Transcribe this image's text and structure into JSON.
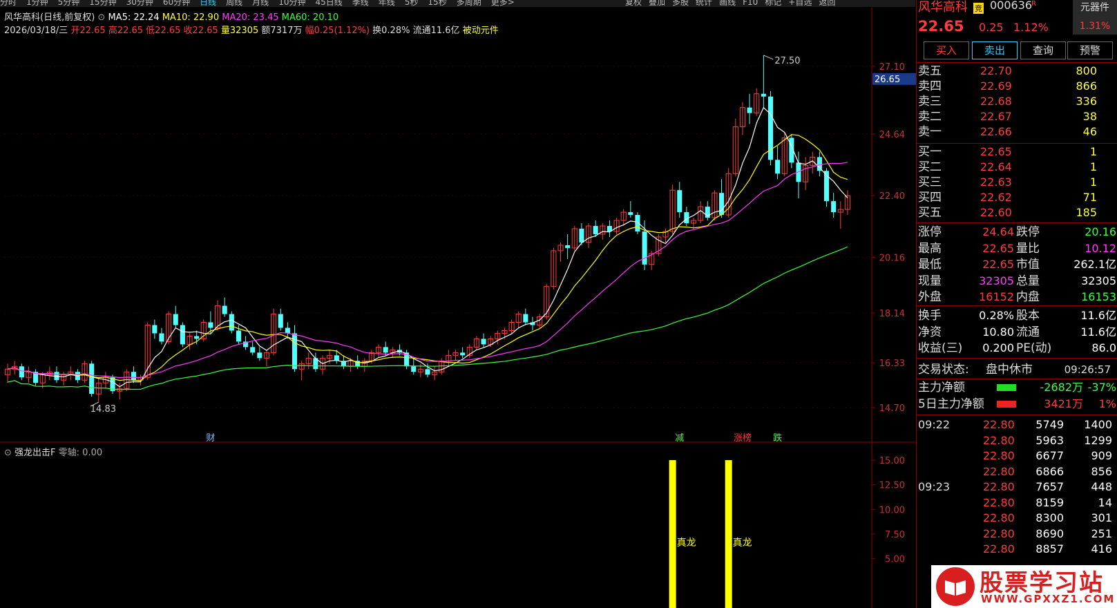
{
  "topbar": {
    "periods": [
      "分时",
      "1分钟",
      "5分钟",
      "15分钟",
      "30分钟",
      "60分钟",
      "日线",
      "周线",
      "月线",
      "10分钟",
      "45日线",
      "季线",
      "年线",
      "5秒",
      "15秒",
      "多周期",
      "更多>"
    ],
    "active": "日线",
    "right_tools": [
      "复权",
      "叠加",
      "多股",
      "统计",
      "画线",
      "F10",
      "标记",
      "+自选",
      "返回"
    ]
  },
  "header": {
    "stock": "风华高科(日线,前复权)",
    "ma5": "MA5: 22.24",
    "ma10": "MA10: 22.90",
    "ma20": "MA20: 23.45",
    "ma60": "MA60: 20.10",
    "date": "2026/03/18/三",
    "open": "开22.65",
    "high": "高22.65",
    "low": "低22.65",
    "close": "收22.65",
    "vol": "量32305",
    "amount": "额7317万",
    "change": "幅0.25(1.12%)",
    "turnover": "换0.28%",
    "float": "流通11.6亿",
    "passive": "被动元件"
  },
  "colors": {
    "up": "#ff3c3c",
    "down": "#54ffff",
    "ma5": "#ffffff",
    "ma10": "#ffff00",
    "ma20": "#ff3cff",
    "ma60": "#3cff3c",
    "grid": "#8b0000"
  },
  "chart_data": {
    "type": "candlestick",
    "price_axis": [
      "27.10",
      "24.64",
      "22.40",
      "20.16",
      "18.14",
      "16.33",
      "14.70"
    ],
    "current_price_tag": "26.65",
    "high_label": "27.50",
    "low_label": "14.83",
    "event_markers": [
      {
        "text": "财",
        "color": "#7fbfff"
      },
      {
        "text": "减",
        "color": "#3cff3c"
      },
      {
        "text": "涨榜",
        "color": "#ff3c3c"
      },
      {
        "text": "跌",
        "color": "#3cff3c"
      }
    ],
    "candles_ohlc": [
      [
        15.9,
        16.3,
        15.6,
        16.1
      ],
      [
        16.1,
        16.4,
        15.9,
        16.2
      ],
      [
        16.2,
        16.3,
        15.7,
        15.8
      ],
      [
        15.8,
        16.2,
        15.6,
        16.0
      ],
      [
        16.0,
        16.1,
        15.5,
        15.6
      ],
      [
        15.6,
        16.0,
        15.4,
        15.9
      ],
      [
        15.9,
        16.2,
        15.7,
        16.0
      ],
      [
        16.0,
        16.2,
        15.6,
        15.7
      ],
      [
        15.7,
        16.0,
        15.5,
        15.9
      ],
      [
        15.9,
        16.2,
        15.7,
        16.0
      ],
      [
        16.0,
        16.1,
        15.6,
        15.7
      ],
      [
        15.7,
        16.4,
        15.6,
        16.3
      ],
      [
        16.3,
        16.4,
        15.1,
        15.2
      ],
      [
        15.2,
        15.8,
        14.9,
        15.6
      ],
      [
        15.6,
        16.0,
        15.4,
        15.8
      ],
      [
        15.8,
        15.9,
        15.2,
        15.3
      ],
      [
        15.3,
        15.6,
        15.0,
        15.4
      ],
      [
        15.4,
        16.1,
        15.3,
        16.0
      ],
      [
        16.0,
        16.2,
        15.6,
        15.7
      ],
      [
        15.7,
        15.9,
        15.5,
        15.8
      ],
      [
        15.8,
        17.8,
        15.7,
        17.7
      ],
      [
        17.7,
        17.9,
        17.2,
        17.4
      ],
      [
        17.4,
        17.6,
        17.0,
        17.1
      ],
      [
        17.1,
        18.2,
        17.0,
        18.1
      ],
      [
        18.1,
        18.4,
        17.6,
        17.7
      ],
      [
        17.7,
        17.8,
        16.9,
        17.0
      ],
      [
        17.0,
        17.4,
        16.8,
        17.3
      ],
      [
        17.3,
        17.5,
        17.0,
        17.2
      ],
      [
        17.2,
        17.9,
        17.1,
        17.8
      ],
      [
        17.8,
        18.2,
        17.4,
        17.6
      ],
      [
        17.6,
        18.6,
        17.5,
        18.4
      ],
      [
        18.4,
        18.7,
        18.0,
        18.1
      ],
      [
        18.1,
        18.2,
        17.4,
        17.5
      ],
      [
        17.5,
        17.7,
        17.0,
        17.1
      ],
      [
        17.1,
        17.3,
        16.8,
        16.9
      ],
      [
        16.9,
        17.1,
        16.6,
        16.7
      ],
      [
        16.7,
        16.9,
        16.4,
        16.5
      ],
      [
        16.5,
        16.8,
        16.2,
        16.7
      ],
      [
        16.7,
        18.3,
        16.6,
        18.1
      ],
      [
        18.1,
        18.3,
        17.5,
        17.6
      ],
      [
        17.6,
        17.8,
        17.2,
        17.4
      ],
      [
        17.4,
        17.7,
        16.0,
        16.1
      ],
      [
        16.1,
        16.4,
        15.7,
        16.3
      ],
      [
        16.3,
        16.7,
        16.1,
        16.5
      ],
      [
        16.5,
        16.7,
        16.0,
        16.1
      ],
      [
        16.1,
        16.6,
        15.9,
        16.5
      ],
      [
        16.5,
        16.8,
        16.3,
        16.6
      ],
      [
        16.6,
        16.8,
        16.3,
        16.4
      ],
      [
        16.4,
        16.6,
        16.1,
        16.2
      ],
      [
        16.2,
        16.5,
        16.0,
        16.4
      ],
      [
        16.4,
        16.6,
        16.1,
        16.2
      ],
      [
        16.2,
        16.5,
        16.0,
        16.4
      ],
      [
        16.4,
        16.8,
        16.3,
        16.7
      ],
      [
        16.7,
        17.0,
        16.5,
        16.9
      ],
      [
        16.9,
        17.1,
        16.6,
        16.7
      ],
      [
        16.7,
        16.9,
        16.5,
        16.8
      ],
      [
        16.8,
        17.0,
        16.6,
        16.7
      ],
      [
        16.7,
        16.8,
        16.1,
        16.2
      ],
      [
        16.2,
        16.5,
        15.9,
        16.0
      ],
      [
        16.0,
        16.3,
        15.8,
        16.1
      ],
      [
        16.1,
        16.3,
        15.8,
        15.9
      ],
      [
        15.9,
        16.2,
        15.7,
        16.0
      ],
      [
        16.0,
        16.5,
        15.9,
        16.4
      ],
      [
        16.4,
        16.8,
        16.2,
        16.6
      ],
      [
        16.6,
        16.8,
        16.4,
        16.7
      ],
      [
        16.7,
        16.9,
        16.5,
        16.6
      ],
      [
        16.6,
        17.0,
        16.5,
        16.9
      ],
      [
        16.9,
        17.3,
        16.8,
        17.2
      ],
      [
        17.2,
        17.4,
        16.9,
        17.0
      ],
      [
        17.0,
        17.3,
        16.9,
        17.2
      ],
      [
        17.2,
        17.5,
        17.0,
        17.4
      ],
      [
        17.4,
        17.6,
        17.2,
        17.5
      ],
      [
        17.5,
        17.9,
        17.4,
        17.8
      ],
      [
        17.8,
        18.2,
        17.6,
        18.1
      ],
      [
        18.1,
        18.3,
        17.7,
        17.8
      ],
      [
        17.8,
        18.0,
        17.5,
        17.7
      ],
      [
        17.7,
        18.1,
        17.6,
        18.0
      ],
      [
        18.0,
        19.2,
        17.9,
        19.1
      ],
      [
        19.1,
        20.5,
        19.0,
        20.4
      ],
      [
        20.4,
        20.7,
        20.0,
        20.6
      ],
      [
        20.6,
        21.0,
        20.1,
        20.5
      ],
      [
        20.5,
        21.3,
        20.4,
        21.2
      ],
      [
        21.2,
        21.4,
        20.6,
        20.7
      ],
      [
        20.7,
        21.4,
        20.5,
        21.3
      ],
      [
        21.3,
        21.5,
        20.9,
        21.0
      ],
      [
        21.0,
        21.4,
        20.8,
        21.3
      ],
      [
        21.3,
        21.5,
        20.9,
        21.1
      ],
      [
        21.1,
        21.6,
        21.0,
        21.5
      ],
      [
        21.5,
        21.9,
        21.3,
        21.8
      ],
      [
        21.8,
        22.2,
        21.6,
        21.7
      ],
      [
        21.7,
        21.8,
        21.0,
        21.1
      ],
      [
        21.1,
        21.5,
        19.7,
        19.9
      ],
      [
        19.9,
        20.4,
        19.7,
        20.3
      ],
      [
        20.3,
        21.0,
        20.2,
        20.9
      ],
      [
        20.9,
        21.2,
        20.7,
        21.1
      ],
      [
        21.1,
        22.8,
        21.0,
        22.6
      ],
      [
        22.6,
        22.9,
        21.6,
        21.8
      ],
      [
        21.8,
        22.0,
        21.3,
        21.4
      ],
      [
        21.4,
        21.6,
        21.2,
        21.5
      ],
      [
        21.5,
        22.2,
        21.4,
        22.0
      ],
      [
        22.0,
        22.2,
        21.5,
        21.6
      ],
      [
        21.6,
        22.6,
        21.5,
        22.5
      ],
      [
        22.5,
        23.0,
        21.6,
        21.7
      ],
      [
        21.7,
        23.4,
        21.6,
        23.2
      ],
      [
        23.2,
        25.2,
        23.1,
        24.9
      ],
      [
        24.9,
        25.8,
        24.6,
        25.6
      ],
      [
        25.6,
        26.1,
        25.0,
        25.4
      ],
      [
        25.4,
        26.3,
        25.3,
        26.1
      ],
      [
        26.1,
        27.5,
        25.6,
        26.0
      ],
      [
        26.0,
        26.2,
        23.5,
        23.7
      ],
      [
        23.7,
        24.2,
        23.0,
        23.2
      ],
      [
        23.2,
        24.7,
        23.1,
        24.5
      ],
      [
        24.5,
        24.6,
        23.4,
        23.6
      ],
      [
        23.6,
        24.0,
        22.3,
        22.9
      ],
      [
        22.9,
        23.8,
        22.6,
        23.5
      ],
      [
        23.5,
        24.0,
        23.2,
        23.8
      ],
      [
        23.8,
        24.0,
        23.1,
        23.3
      ],
      [
        23.3,
        23.4,
        22.0,
        22.2
      ],
      [
        22.2,
        22.5,
        21.6,
        21.8
      ],
      [
        21.8,
        22.2,
        21.2,
        21.9
      ],
      [
        21.9,
        22.6,
        21.7,
        22.4
      ]
    ],
    "indicator": {
      "name": "强龙出击F",
      "zero_axis": "零轴: 0.00",
      "axis": [
        "15.00",
        "12.50",
        "10.00",
        "7.50",
        "5.00"
      ],
      "signals": [
        {
          "index": 95,
          "value": 15,
          "label": "真龙"
        },
        {
          "index": 103,
          "value": 15,
          "label": "真龙"
        }
      ]
    }
  },
  "panel": {
    "name": "风华高科",
    "badge": "竞",
    "code": "000636",
    "code_badge": "R",
    "sector": "元器件",
    "sector_pct": "1.31%",
    "price": "22.65",
    "change": "0.25",
    "pct": "1.12%",
    "buttons": [
      "买入",
      "卖出",
      "查询",
      "预警"
    ],
    "asks": [
      {
        "label": "卖五",
        "price": "22.70",
        "vol": "800"
      },
      {
        "label": "卖四",
        "price": "22.69",
        "vol": "866"
      },
      {
        "label": "卖三",
        "price": "22.68",
        "vol": "336"
      },
      {
        "label": "卖二",
        "price": "22.67",
        "vol": "38"
      },
      {
        "label": "卖一",
        "price": "22.66",
        "vol": "46"
      }
    ],
    "bids": [
      {
        "label": "买一",
        "price": "22.65",
        "vol": "1"
      },
      {
        "label": "买二",
        "price": "22.64",
        "vol": "1"
      },
      {
        "label": "买三",
        "price": "22.63",
        "vol": "1"
      },
      {
        "label": "买四",
        "price": "22.62",
        "vol": "71"
      },
      {
        "label": "买五",
        "price": "22.60",
        "vol": "185"
      }
    ],
    "stats": [
      {
        "l1": "涨停",
        "v1": "24.64",
        "c1": "red",
        "l2": "跌停",
        "v2": "20.16",
        "c2": "green"
      },
      {
        "l1": "最高",
        "v1": "22.65",
        "c1": "red",
        "l2": "量比",
        "v2": "10.12",
        "c2": "mag"
      },
      {
        "l1": "最低",
        "v1": "22.65",
        "c1": "red",
        "l2": "市值",
        "v2": "262.1亿",
        "c2": "white"
      },
      {
        "l1": "现量",
        "v1": "32305",
        "c1": "mag",
        "l2": "总量",
        "v2": "32305",
        "c2": "white"
      },
      {
        "l1": "外盘",
        "v1": "16152",
        "c1": "red",
        "l2": "内盘",
        "v2": "16153",
        "c2": "green"
      }
    ],
    "stats2": [
      {
        "l1": "换手",
        "v1": "0.28%",
        "l2": "股本",
        "v2": "11.6亿"
      },
      {
        "l1": "净资",
        "v1": "10.80",
        "l2": "流通",
        "v2": "11.6亿"
      },
      {
        "l1": "收益(三)",
        "v1": "0.200",
        "l2": "PE(动)",
        "v2": "86.0"
      }
    ],
    "status_label": "交易状态:",
    "status_value": "盘中休市",
    "status_time": "09:26:57",
    "flow": [
      {
        "label": "主力净额",
        "value": "-2682万",
        "pct": "-37%",
        "color": "green"
      },
      {
        "label": "5日主力净额",
        "value": "3421万",
        "pct": "1%",
        "color": "red"
      }
    ],
    "ticks": [
      {
        "time": "09:22",
        "price": "22.80",
        "vol": "5749",
        "amt": "1400"
      },
      {
        "time": "",
        "price": "22.80",
        "vol": "5963",
        "amt": "1299"
      },
      {
        "time": "",
        "price": "22.80",
        "vol": "6677",
        "amt": "909"
      },
      {
        "time": "",
        "price": "22.80",
        "vol": "6866",
        "amt": "856"
      },
      {
        "time": "09:23",
        "price": "22.80",
        "vol": "7657",
        "amt": "448"
      },
      {
        "time": "",
        "price": "22.80",
        "vol": "8159",
        "amt": "14"
      },
      {
        "time": "",
        "price": "22.80",
        "vol": "8300",
        "amt": "301"
      },
      {
        "time": "",
        "price": "22.80",
        "vol": "8690",
        "amt": "251"
      },
      {
        "time": "",
        "price": "22.80",
        "vol": "8857",
        "amt": "416"
      }
    ]
  },
  "watermark": {
    "title": "股票学习站",
    "url": "WWW.GPXXZ1.COM"
  }
}
